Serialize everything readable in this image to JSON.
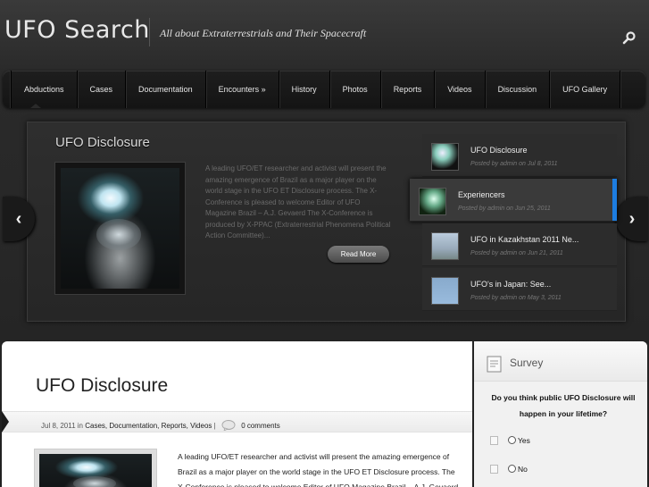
{
  "header": {
    "logo": "UFO Search",
    "tagline": "All about Extraterrestrials and Their Spacecraft",
    "search_icon": "search-icon"
  },
  "nav": {
    "items": [
      {
        "label": "Abductions"
      },
      {
        "label": "Cases"
      },
      {
        "label": "Documentation"
      },
      {
        "label": "Encounters »"
      },
      {
        "label": "History"
      },
      {
        "label": "Photos"
      },
      {
        "label": "Reports"
      },
      {
        "label": "Videos"
      },
      {
        "label": "Discussion"
      },
      {
        "label": "UFO Gallery"
      }
    ]
  },
  "featured": {
    "title": "UFO Disclosure",
    "excerpt": "A leading UFO/ET researcher and activist will present the amazing emergence of Brazil as a major player on the world stage in the UFO ET Disclosure process. The X-Conference is pleased to welcome Editor of UFO Magazine Brazil – A.J. Gevaerd The X-Conference is produced by X-PPAC (Extraterrestrial Phenomena Political Action Committee)...",
    "read_more": "Read More",
    "prev_icon": "chevron-left-icon",
    "next_icon": "chevron-right-icon"
  },
  "slides": [
    {
      "title": "UFO Disclosure",
      "meta": "Posted by admin on Jul 8, 2011"
    },
    {
      "title": "Experiencers",
      "meta": "Posted by admin on Jun 25, 2011"
    },
    {
      "title": "UFO in Kazakhstan 2011 Ne...",
      "meta": "Posted by admin on Jun 21, 2011"
    },
    {
      "title": "UFO's in Japan: See...",
      "meta": "Posted by admin on May 3, 2011"
    }
  ],
  "post": {
    "title": "UFO Disclosure",
    "date": "Jul 8, 2011",
    "in": "in",
    "categories": "Cases, Documentation, Reports, Videos",
    "separator": "|",
    "comments": "0 comments",
    "text": "A leading UFO/ET researcher and activist will present the amazing emergence of Brazil as a major player on the world stage in the UFO ET Disclosure process. The X-Conference is pleased to welcome Editor of UFO Magazine Brazil – A.J. Gevaerd"
  },
  "survey": {
    "title": "Survey",
    "question": "Do you think public UFO Disclosure will happen in your lifetime?",
    "options": [
      {
        "label": "Yes"
      },
      {
        "label": "No"
      }
    ]
  },
  "colors": {
    "accent": "#1d7de0",
    "nav_bg": "#141414",
    "page_bg": "#2b2b2b"
  }
}
